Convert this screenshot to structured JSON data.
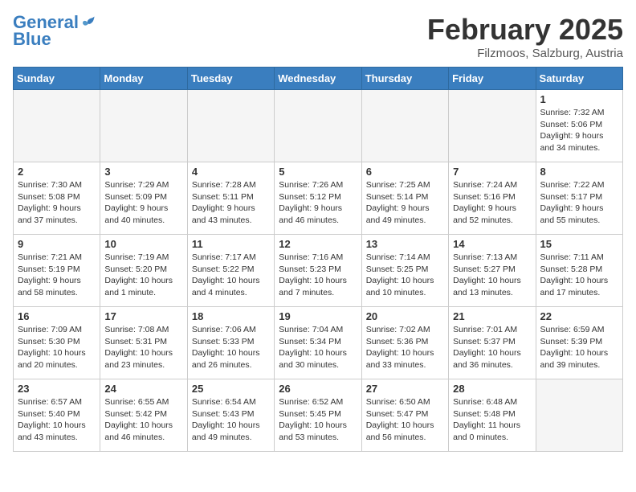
{
  "header": {
    "logo_line1": "General",
    "logo_line2": "Blue",
    "title": "February 2025",
    "subtitle": "Filzmoos, Salzburg, Austria"
  },
  "weekdays": [
    "Sunday",
    "Monday",
    "Tuesday",
    "Wednesday",
    "Thursday",
    "Friday",
    "Saturday"
  ],
  "weeks": [
    [
      {
        "day": "",
        "info": ""
      },
      {
        "day": "",
        "info": ""
      },
      {
        "day": "",
        "info": ""
      },
      {
        "day": "",
        "info": ""
      },
      {
        "day": "",
        "info": ""
      },
      {
        "day": "",
        "info": ""
      },
      {
        "day": "1",
        "info": "Sunrise: 7:32 AM\nSunset: 5:06 PM\nDaylight: 9 hours and 34 minutes."
      }
    ],
    [
      {
        "day": "2",
        "info": "Sunrise: 7:30 AM\nSunset: 5:08 PM\nDaylight: 9 hours and 37 minutes."
      },
      {
        "day": "3",
        "info": "Sunrise: 7:29 AM\nSunset: 5:09 PM\nDaylight: 9 hours and 40 minutes."
      },
      {
        "day": "4",
        "info": "Sunrise: 7:28 AM\nSunset: 5:11 PM\nDaylight: 9 hours and 43 minutes."
      },
      {
        "day": "5",
        "info": "Sunrise: 7:26 AM\nSunset: 5:12 PM\nDaylight: 9 hours and 46 minutes."
      },
      {
        "day": "6",
        "info": "Sunrise: 7:25 AM\nSunset: 5:14 PM\nDaylight: 9 hours and 49 minutes."
      },
      {
        "day": "7",
        "info": "Sunrise: 7:24 AM\nSunset: 5:16 PM\nDaylight: 9 hours and 52 minutes."
      },
      {
        "day": "8",
        "info": "Sunrise: 7:22 AM\nSunset: 5:17 PM\nDaylight: 9 hours and 55 minutes."
      }
    ],
    [
      {
        "day": "9",
        "info": "Sunrise: 7:21 AM\nSunset: 5:19 PM\nDaylight: 9 hours and 58 minutes."
      },
      {
        "day": "10",
        "info": "Sunrise: 7:19 AM\nSunset: 5:20 PM\nDaylight: 10 hours and 1 minute."
      },
      {
        "day": "11",
        "info": "Sunrise: 7:17 AM\nSunset: 5:22 PM\nDaylight: 10 hours and 4 minutes."
      },
      {
        "day": "12",
        "info": "Sunrise: 7:16 AM\nSunset: 5:23 PM\nDaylight: 10 hours and 7 minutes."
      },
      {
        "day": "13",
        "info": "Sunrise: 7:14 AM\nSunset: 5:25 PM\nDaylight: 10 hours and 10 minutes."
      },
      {
        "day": "14",
        "info": "Sunrise: 7:13 AM\nSunset: 5:27 PM\nDaylight: 10 hours and 13 minutes."
      },
      {
        "day": "15",
        "info": "Sunrise: 7:11 AM\nSunset: 5:28 PM\nDaylight: 10 hours and 17 minutes."
      }
    ],
    [
      {
        "day": "16",
        "info": "Sunrise: 7:09 AM\nSunset: 5:30 PM\nDaylight: 10 hours and 20 minutes."
      },
      {
        "day": "17",
        "info": "Sunrise: 7:08 AM\nSunset: 5:31 PM\nDaylight: 10 hours and 23 minutes."
      },
      {
        "day": "18",
        "info": "Sunrise: 7:06 AM\nSunset: 5:33 PM\nDaylight: 10 hours and 26 minutes."
      },
      {
        "day": "19",
        "info": "Sunrise: 7:04 AM\nSunset: 5:34 PM\nDaylight: 10 hours and 30 minutes."
      },
      {
        "day": "20",
        "info": "Sunrise: 7:02 AM\nSunset: 5:36 PM\nDaylight: 10 hours and 33 minutes."
      },
      {
        "day": "21",
        "info": "Sunrise: 7:01 AM\nSunset: 5:37 PM\nDaylight: 10 hours and 36 minutes."
      },
      {
        "day": "22",
        "info": "Sunrise: 6:59 AM\nSunset: 5:39 PM\nDaylight: 10 hours and 39 minutes."
      }
    ],
    [
      {
        "day": "23",
        "info": "Sunrise: 6:57 AM\nSunset: 5:40 PM\nDaylight: 10 hours and 43 minutes."
      },
      {
        "day": "24",
        "info": "Sunrise: 6:55 AM\nSunset: 5:42 PM\nDaylight: 10 hours and 46 minutes."
      },
      {
        "day": "25",
        "info": "Sunrise: 6:54 AM\nSunset: 5:43 PM\nDaylight: 10 hours and 49 minutes."
      },
      {
        "day": "26",
        "info": "Sunrise: 6:52 AM\nSunset: 5:45 PM\nDaylight: 10 hours and 53 minutes."
      },
      {
        "day": "27",
        "info": "Sunrise: 6:50 AM\nSunset: 5:47 PM\nDaylight: 10 hours and 56 minutes."
      },
      {
        "day": "28",
        "info": "Sunrise: 6:48 AM\nSunset: 5:48 PM\nDaylight: 11 hours and 0 minutes."
      },
      {
        "day": "",
        "info": ""
      }
    ]
  ]
}
